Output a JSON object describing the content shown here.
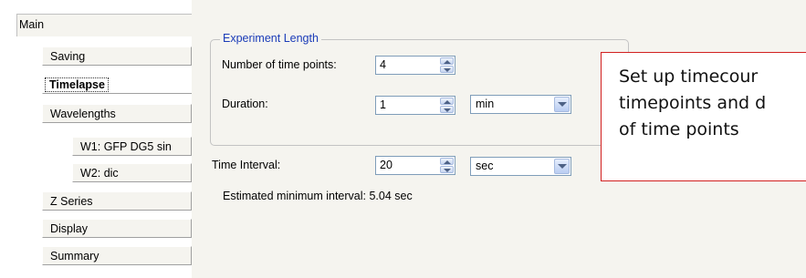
{
  "sidebar": {
    "items": [
      {
        "label": "Main"
      },
      {
        "label": "Saving"
      },
      {
        "label": "Timelapse"
      },
      {
        "label": "Wavelengths"
      },
      {
        "label": "W1: GFP DG5 sin"
      },
      {
        "label": "W2: dic"
      },
      {
        "label": "Z Series"
      },
      {
        "label": "Display"
      },
      {
        "label": "Summary"
      }
    ],
    "selected": "Timelapse"
  },
  "experiment_length": {
    "title": "Experiment Length",
    "time_points": {
      "label": "Number of time points:",
      "value": "4"
    },
    "duration": {
      "label": "Duration:",
      "value": "1",
      "unit": "min"
    }
  },
  "time_interval": {
    "label": "Time Interval:",
    "value": "20",
    "unit": "sec"
  },
  "estimate": "Estimated minimum interval: 5.04 sec",
  "callout": {
    "lines": [
      "Set up timecour",
      "timepoints and d",
      "of time points"
    ],
    "border_color": "#d22020"
  },
  "colors": {
    "group_title": "#1a3bb8",
    "panel_bg": "#f5f4ef"
  }
}
